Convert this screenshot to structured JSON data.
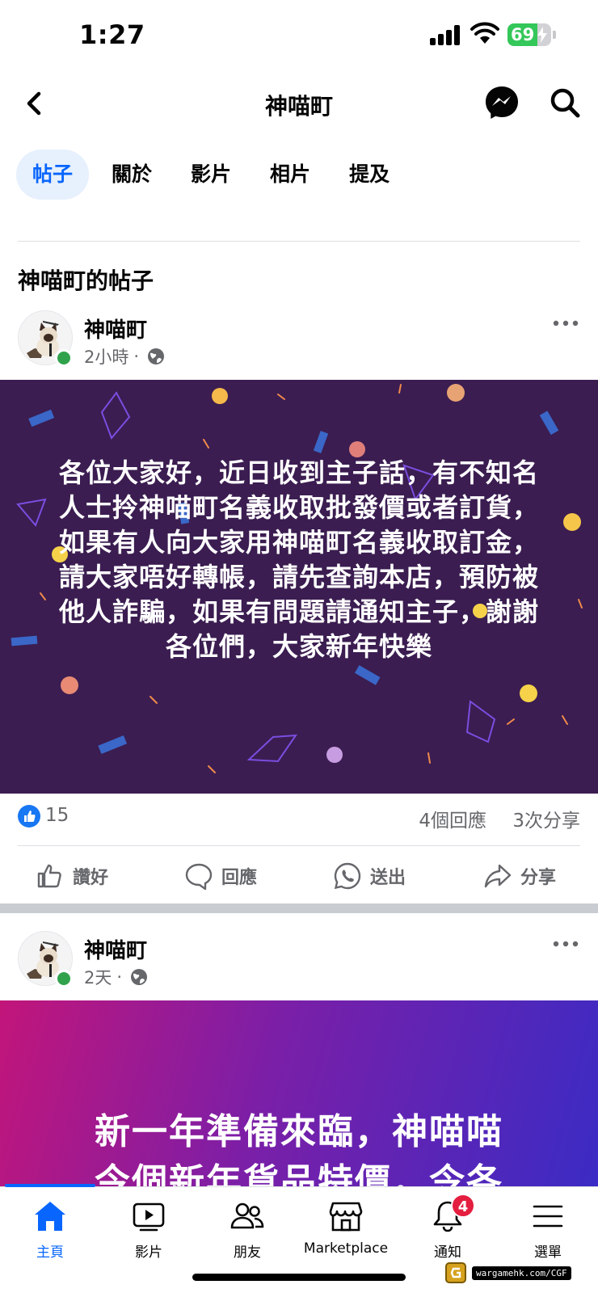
{
  "status_bar": {
    "time": "1:27",
    "battery_level": "69",
    "battery_fraction": 0.69,
    "battery_color": "#34c759"
  },
  "header": {
    "title": "神喵町",
    "back_icon": "chevron-left-icon",
    "messenger_icon": "messenger-icon",
    "search_icon": "search-icon"
  },
  "tabs": [
    {
      "label": "帖子",
      "active": true
    },
    {
      "label": "關於",
      "active": false
    },
    {
      "label": "影片",
      "active": false
    },
    {
      "label": "相片",
      "active": false
    },
    {
      "label": "提及",
      "active": false
    }
  ],
  "section_title": "神喵町的帖子",
  "posts": [
    {
      "author": "神喵町",
      "time": "2小時",
      "privacy_icon": "globe-icon",
      "body": "各位大家好，近日收到主子話，有不知名人士拎神喵町名義收取批發價或者訂貨，如果有人向大家用神喵町名義收取訂金，請大家唔好轉帳，請先查詢本店，預防被他人詐騙，如果有問題請通知主子，謝謝各位們，大家新年快樂",
      "background_color": "#3b1d51",
      "likes": "15",
      "comments": "4個回應",
      "shares": "3次分享"
    },
    {
      "author": "神喵町",
      "time": "2天",
      "privacy_icon": "globe-icon",
      "body": "新一年準備來臨，神喵喵\n今個新年貨品特價，令各"
    }
  ],
  "actions": {
    "like": "讚好",
    "comment": "回應",
    "send": "送出",
    "share": "分享"
  },
  "bottom_nav": {
    "items": [
      {
        "label": "主頁",
        "icon": "home-icon",
        "active": true
      },
      {
        "label": "影片",
        "icon": "video-icon"
      },
      {
        "label": "朋友",
        "icon": "friends-icon"
      },
      {
        "label": "Marketplace",
        "icon": "marketplace-icon"
      },
      {
        "label": "通知",
        "icon": "bell-icon",
        "badge": "4"
      },
      {
        "label": "選單",
        "icon": "menu-icon"
      }
    ]
  },
  "watermark": "wargamehk.com/CGF",
  "colors": {
    "accent": "#0866ff",
    "like_blue": "#1877f2",
    "badge_red": "#e41e3f",
    "secondary_text": "#65676b"
  }
}
